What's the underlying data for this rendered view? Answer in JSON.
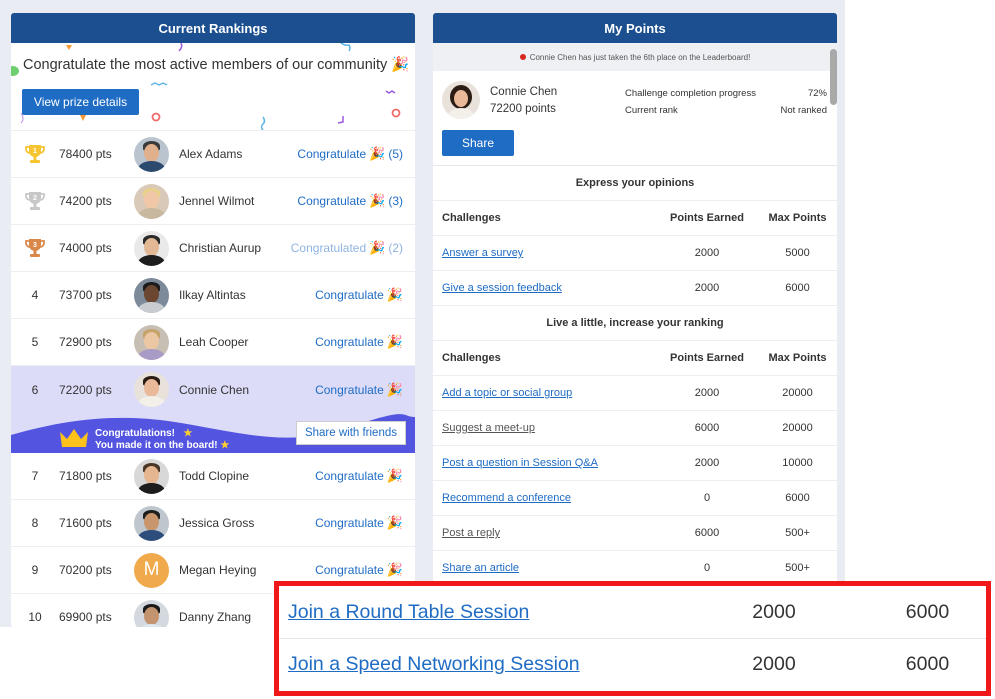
{
  "colors": {
    "header": "#1b4f8f",
    "primary": "#1f6cc4",
    "highlight_row": "#dcdcf8",
    "banner": "#5355e0",
    "callout_border": "#f01818",
    "gold": "#f7c531",
    "silver": "#c8c8c8",
    "bronze": "#d9884a"
  },
  "rankings": {
    "title": "Current Rankings",
    "intro": "Congratulate the most active members of our community 🎉",
    "prize_button": "View prize details",
    "rows": [
      {
        "rank": "1",
        "icon": "gold-trophy-icon",
        "points": "78400 pts",
        "name": "Alex Adams",
        "action": "Congratulate",
        "count": "(5)",
        "done": false
      },
      {
        "rank": "2",
        "icon": "silver-trophy-icon",
        "points": "74200 pts",
        "name": "Jennel Wilmot",
        "action": "Congratulate",
        "count": "(3)",
        "done": false
      },
      {
        "rank": "3",
        "icon": "bronze-trophy-icon",
        "points": "74000 pts",
        "name": "Christian Aurup",
        "action": "Congratulated",
        "count": "(2)",
        "done": true
      },
      {
        "rank": "4",
        "points": "73700 pts",
        "name": "Ilkay Altintas",
        "action": "Congratulate",
        "count": ""
      },
      {
        "rank": "5",
        "points": "72900 pts",
        "name": "Leah Cooper",
        "action": "Congratulate",
        "count": ""
      },
      {
        "rank": "6",
        "points": "72200 pts",
        "name": "Connie Chen",
        "action": "Congratulate",
        "count": "",
        "highlight": true
      },
      {
        "rank": "7",
        "points": "71800 pts",
        "name": "Todd Clopine",
        "action": "Congratulate",
        "count": ""
      },
      {
        "rank": "8",
        "points": "71600 pts",
        "name": "Jessica Gross",
        "action": "Congratulate",
        "count": ""
      },
      {
        "rank": "9",
        "points": "70200 pts",
        "name": "Megan Heying",
        "action": "Congratulate",
        "count": "",
        "avatar_letter": "M"
      },
      {
        "rank": "10",
        "points": "69900 pts",
        "name": "Danny Zhang",
        "action": "",
        "count": ""
      }
    ],
    "banner": {
      "line1": "Congratulations!",
      "line2": "You made it on the board!",
      "share_button": "Share with friends"
    }
  },
  "my_points": {
    "title": "My Points",
    "notice": "Connie Chen has just taken the 6th place on the Leaderboard!",
    "profile": {
      "name": "Connie Chen",
      "points": "72200 points",
      "progress_label": "Challenge completion progress",
      "progress_value": "72%",
      "rank_label": "Current rank",
      "rank_value": "Not ranked",
      "share_button": "Share"
    },
    "columns": [
      "Challenges",
      "Points Earned",
      "Max Points"
    ],
    "sections": [
      {
        "title": "Express your opinions",
        "rows": [
          {
            "challenge": "Answer a survey",
            "earned": "2000",
            "max": "5000"
          },
          {
            "challenge": "Give a session feedback",
            "earned": "2000",
            "max": "6000"
          }
        ]
      },
      {
        "title": "Live a little, increase your ranking",
        "rows": [
          {
            "challenge": "Add a topic or social group",
            "earned": "2000",
            "max": "20000"
          },
          {
            "challenge": "Suggest a meet-up",
            "earned": "6000",
            "max": "20000",
            "muted": true
          },
          {
            "challenge": "Post a question in Session Q&A",
            "earned": "2000",
            "max": "10000"
          },
          {
            "challenge": "Recommend a conference",
            "earned": "0",
            "max": "6000"
          },
          {
            "challenge": "Post a reply",
            "earned": "6000",
            "max": "500+",
            "muted": true
          },
          {
            "challenge": "Share an article",
            "earned": "0",
            "max": "500+"
          }
        ]
      }
    ]
  },
  "callout": {
    "rows": [
      {
        "challenge": "Join a Round Table Session",
        "earned": "2000",
        "max": "6000"
      },
      {
        "challenge": "Join a Speed Networking Session",
        "earned": "2000",
        "max": "6000"
      }
    ]
  }
}
